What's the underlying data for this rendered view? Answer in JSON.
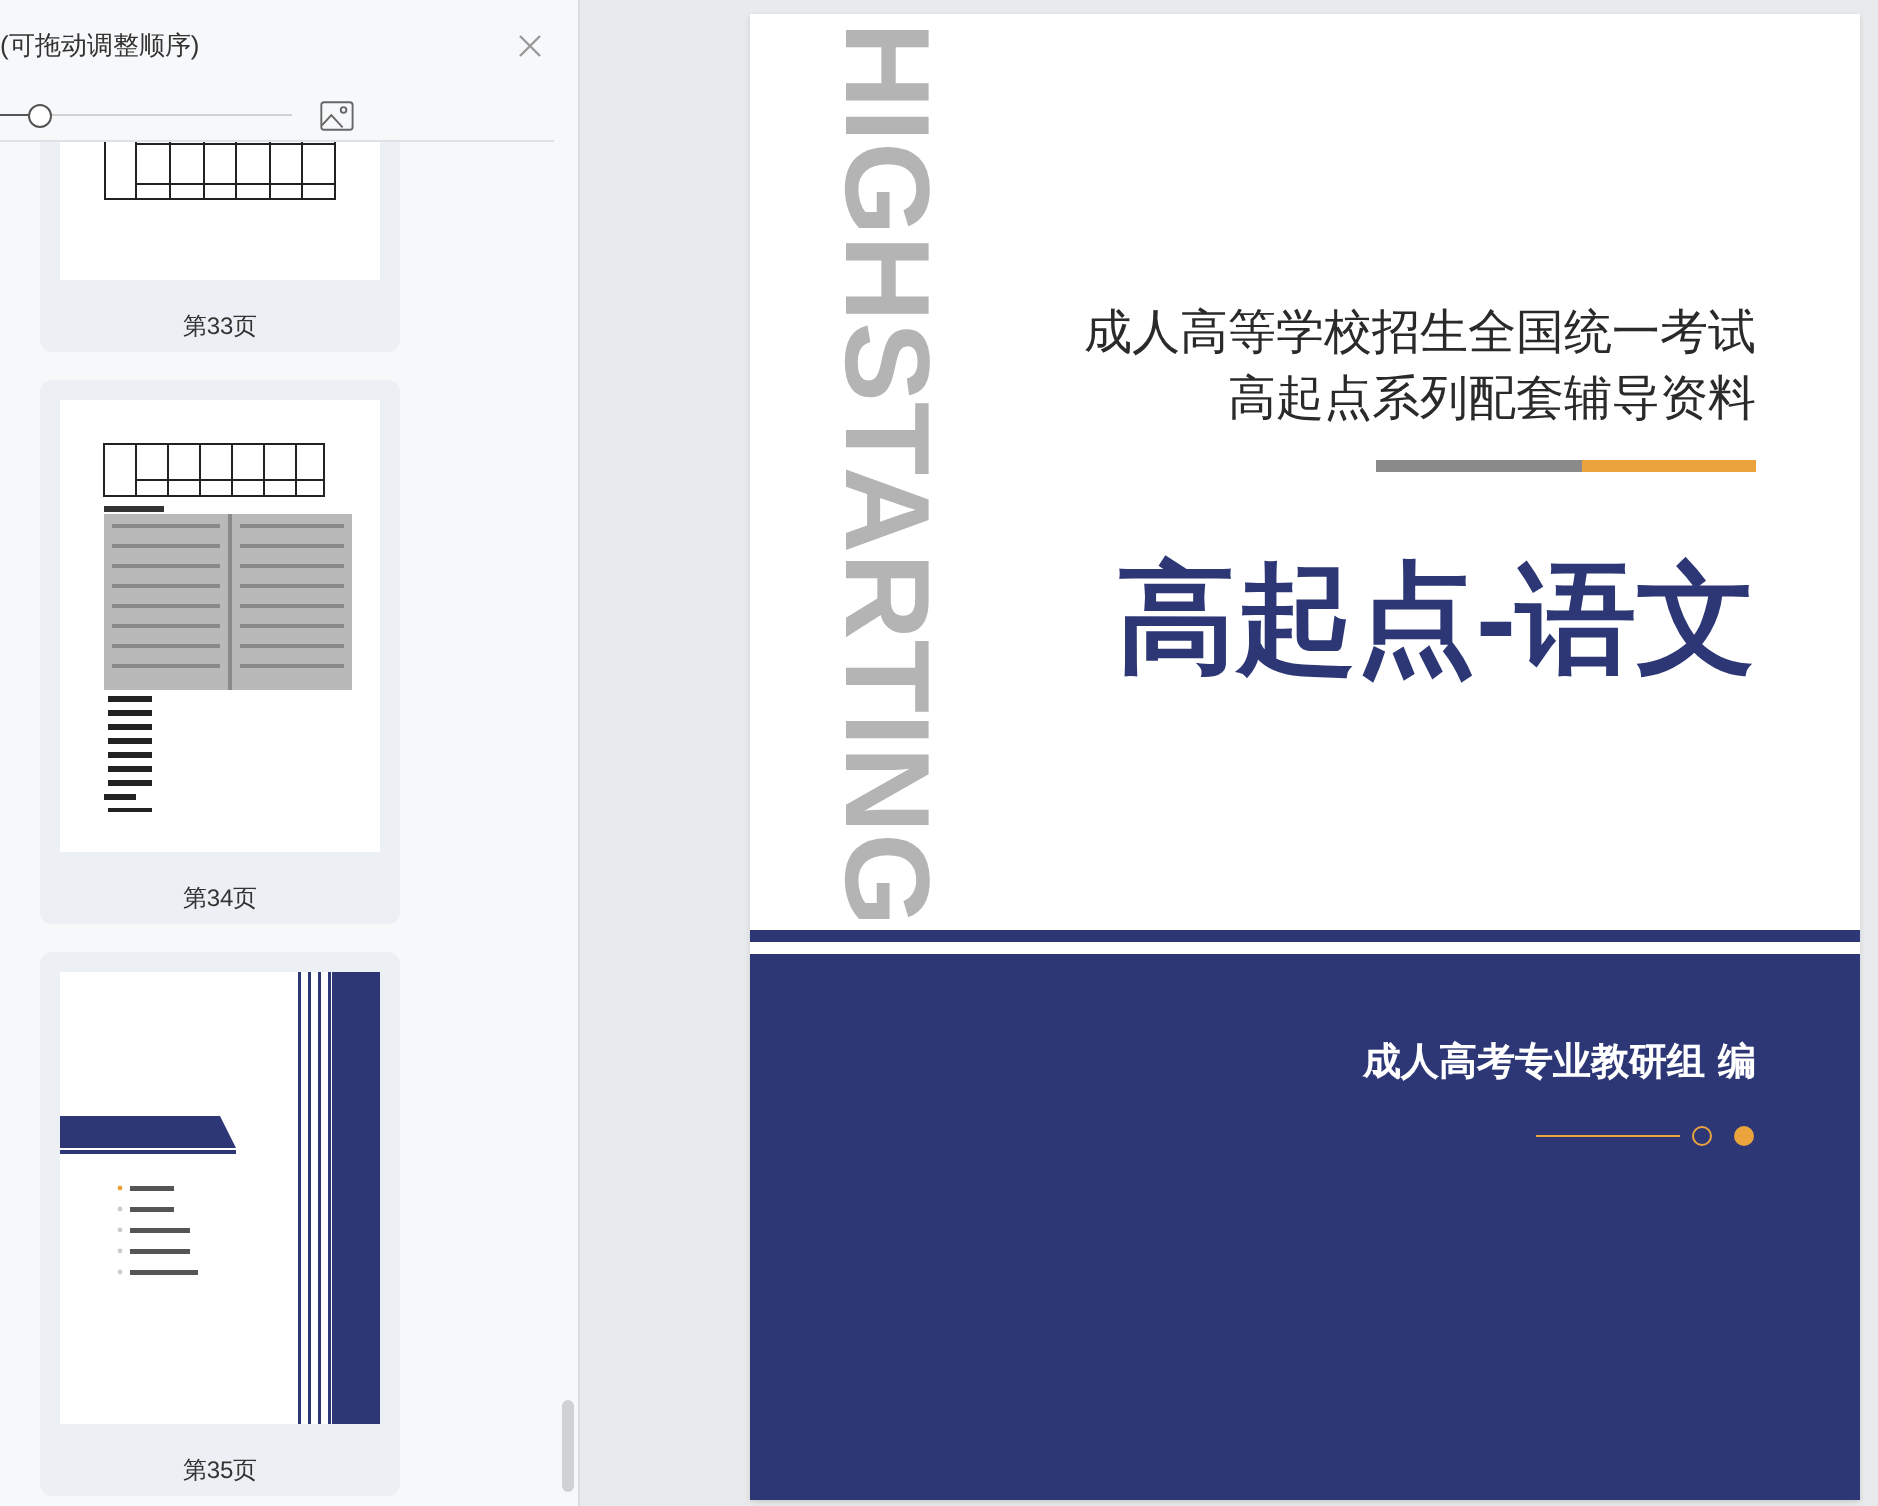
{
  "panel": {
    "title": "(可拖动调整顺序)",
    "zoom": {
      "level": 0.14
    }
  },
  "thumbnails": [
    {
      "label": "第33页",
      "kind": "table"
    },
    {
      "label": "第34页",
      "kind": "scan"
    },
    {
      "label": "第35页",
      "kind": "cover"
    }
  ],
  "cover": {
    "watermark": "HIGHSTARTING",
    "subtitle_lines": [
      "成人高等学校招生全国统一考试",
      "高起点系列配套辅导资料"
    ],
    "title": "高起点-语文",
    "editor": "成人高考专业教研组 编"
  }
}
